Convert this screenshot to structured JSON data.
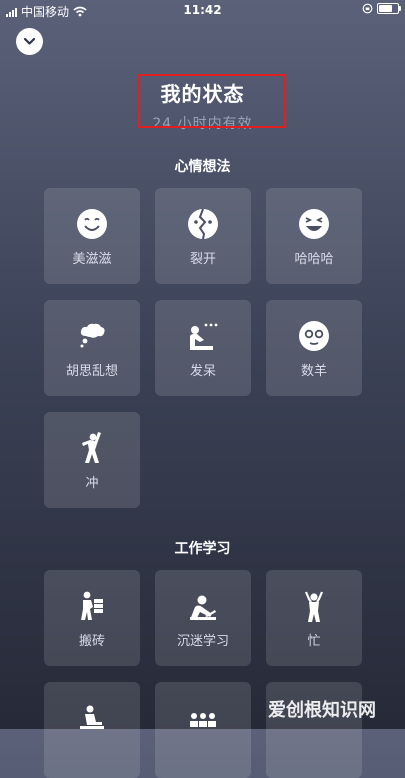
{
  "status_bar": {
    "carrier": "中国移动",
    "time": "11:42",
    "battery_level": 0.8
  },
  "header": {
    "title": "我的状态",
    "subtitle": "24 小时内有效"
  },
  "sections": [
    {
      "title": "心情想法",
      "items": [
        {
          "label": "美滋滋",
          "icon": "smile-icon"
        },
        {
          "label": "裂开",
          "icon": "cracked-face-icon"
        },
        {
          "label": "哈哈哈",
          "icon": "laughing-face-icon"
        },
        {
          "label": "胡思乱想",
          "icon": "thought-bubble-icon"
        },
        {
          "label": "发呆",
          "icon": "daydream-icon"
        },
        {
          "label": "数羊",
          "icon": "sheep-face-icon"
        },
        {
          "label": "冲",
          "icon": "rush-icon"
        }
      ]
    },
    {
      "title": "工作学习",
      "items": [
        {
          "label": "搬砖",
          "icon": "carry-bricks-icon"
        },
        {
          "label": "沉迷学习",
          "icon": "studying-icon"
        },
        {
          "label": "忙",
          "icon": "busy-icon"
        },
        {
          "label": "",
          "icon": "desk-worker-icon"
        },
        {
          "label": "",
          "icon": "meeting-icon"
        },
        {
          "label": "",
          "icon": "partial-icon"
        }
      ]
    }
  ],
  "watermark": "爱创根知识网",
  "colors": {
    "highlight": "#e02020",
    "tile": "rgba(255,255,255,0.13)"
  }
}
